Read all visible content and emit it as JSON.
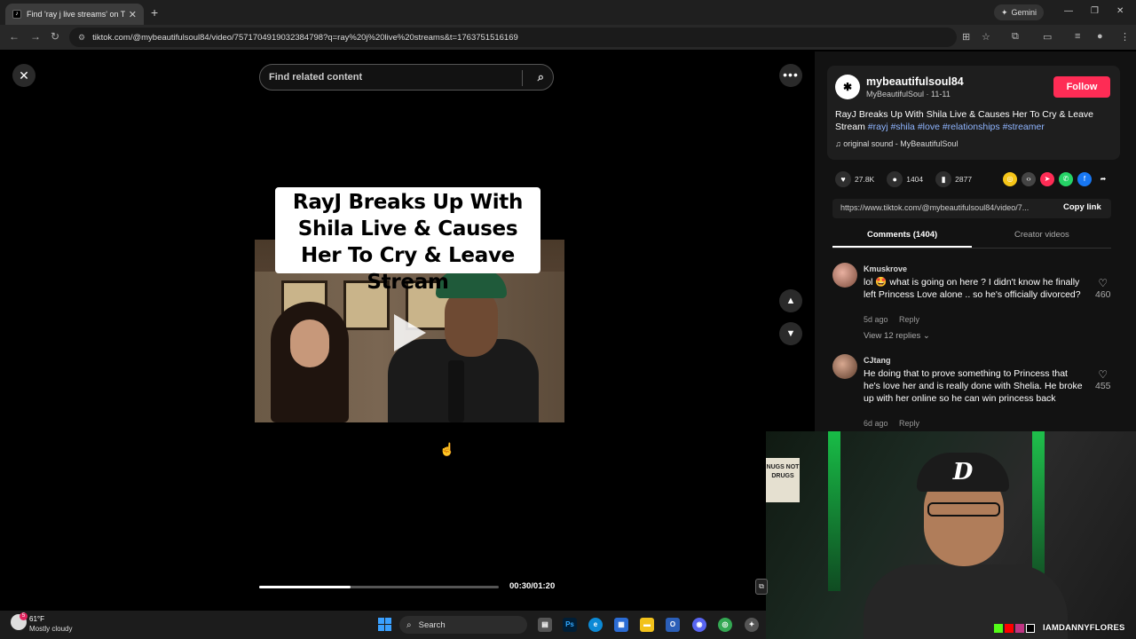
{
  "browser": {
    "tab_title": "Find 'ray j live streams' on TikTok",
    "new_tab": "+",
    "gemini_label": "Gemini",
    "url": "tiktok.com/@mybeautifulsoul84/video/7571704919032384798?q=ray%20j%20live%20streams&t=1763751516169"
  },
  "search": {
    "placeholder": "Find related content"
  },
  "video": {
    "title_text": "RayJ Breaks Up With Shila Live & Causes Her To Cry & Leave Stream",
    "timecode": "00:30/01:20",
    "progress_fraction": 0.38
  },
  "post": {
    "username": "mybeautifulsoul84",
    "subline": "MyBeautifulSoul · 11-11",
    "follow_label": "Follow",
    "description_text": "RayJ Breaks Up With Shila Live & Causes Her To Cry & Leave Stream",
    "hashtags": [
      "#rayj",
      "#shila",
      "#love",
      "#relationships",
      "#streamer"
    ],
    "sound": "original sound - MyBeautifulSoul",
    "likes": "27.8K",
    "comments": "1404",
    "saves": "2877",
    "link": "https://www.tiktok.com/@mybeautifulsoul84/video/7...",
    "copy_link_label": "Copy link"
  },
  "panel_tabs": {
    "comments_tab": "Comments (1404)",
    "creator_tab": "Creator videos"
  },
  "comments": [
    {
      "user": "Kmuskrove",
      "text": "lol 🤩 what is going on here ? I didn't know he finally left Princess Love alone .. so he's officially divorced?",
      "age": "5d ago",
      "reply": "Reply",
      "likes": "460",
      "view_replies": "View 12 replies"
    },
    {
      "user": "CJtang",
      "text": "He doing that to prove something to Princess that he's love her and is really done with Shelia. He broke up with her online so he can win princess back",
      "age": "6d ago",
      "reply": "Reply",
      "likes": "455"
    }
  ],
  "webcam": {
    "handle": "IAMDANNYFLORES",
    "cap_letter": "D",
    "sign_text": "NUGS NOT DRUGS"
  },
  "taskbar": {
    "temp": "61°F",
    "weather": "Mostly cloudy",
    "search_label": "Search",
    "weather_badge": "5"
  },
  "colors": {
    "follow": "#fe2c55",
    "hashtag": "#8fb5ff",
    "accent_windows": "#3aa0ff"
  }
}
